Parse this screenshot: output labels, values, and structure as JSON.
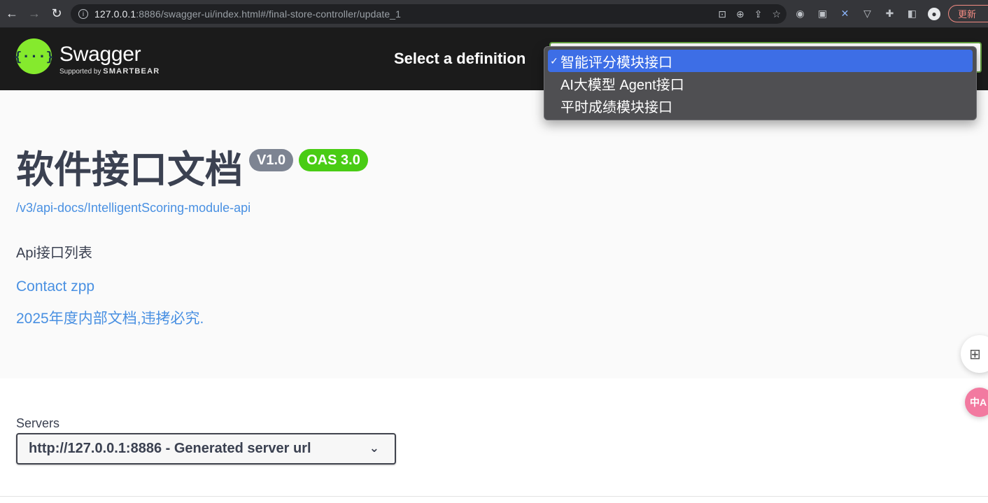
{
  "browser": {
    "url_host": "127.0.0.1",
    "url_rest": ":8886/swagger-ui/index.html#/final-store-controller/update_1",
    "update_label": "更新",
    "extension_icons": [
      "translate-icon",
      "zoom-icon",
      "share-icon",
      "star-icon",
      "extension-a-icon",
      "extension-b-icon",
      "extension-x-icon",
      "vue-icon",
      "puzzle-icon",
      "sidepanel-icon",
      "profile-icon"
    ]
  },
  "header": {
    "logo_glyph": "{···}",
    "logo_title": "Swagger",
    "logo_sub_prefix": "Supported by",
    "logo_sub_brand": "SMARTBEAR",
    "select_label": "Select a definition"
  },
  "definition_menu": {
    "items": [
      {
        "label": "智能评分模块接口",
        "selected": true
      },
      {
        "label": "AI大模型 Agent接口",
        "selected": false
      },
      {
        "label": "平时成绩模块接口",
        "selected": false
      }
    ],
    "check_mark": "✓"
  },
  "info": {
    "title": "软件接口文档",
    "version_badge": "V1.0",
    "oas_badge": "OAS 3.0",
    "spec_url": "/v3/api-docs/IntelligentScoring-module-api",
    "description": "Api接口列表",
    "contact": "Contact zpp",
    "license": "2025年度内部文档,违拷必究."
  },
  "servers": {
    "label": "Servers",
    "selected": "http://127.0.0.1:8886 - Generated server url"
  },
  "floating": {
    "apps_glyph": "⊞",
    "translate_glyph": "中A"
  }
}
